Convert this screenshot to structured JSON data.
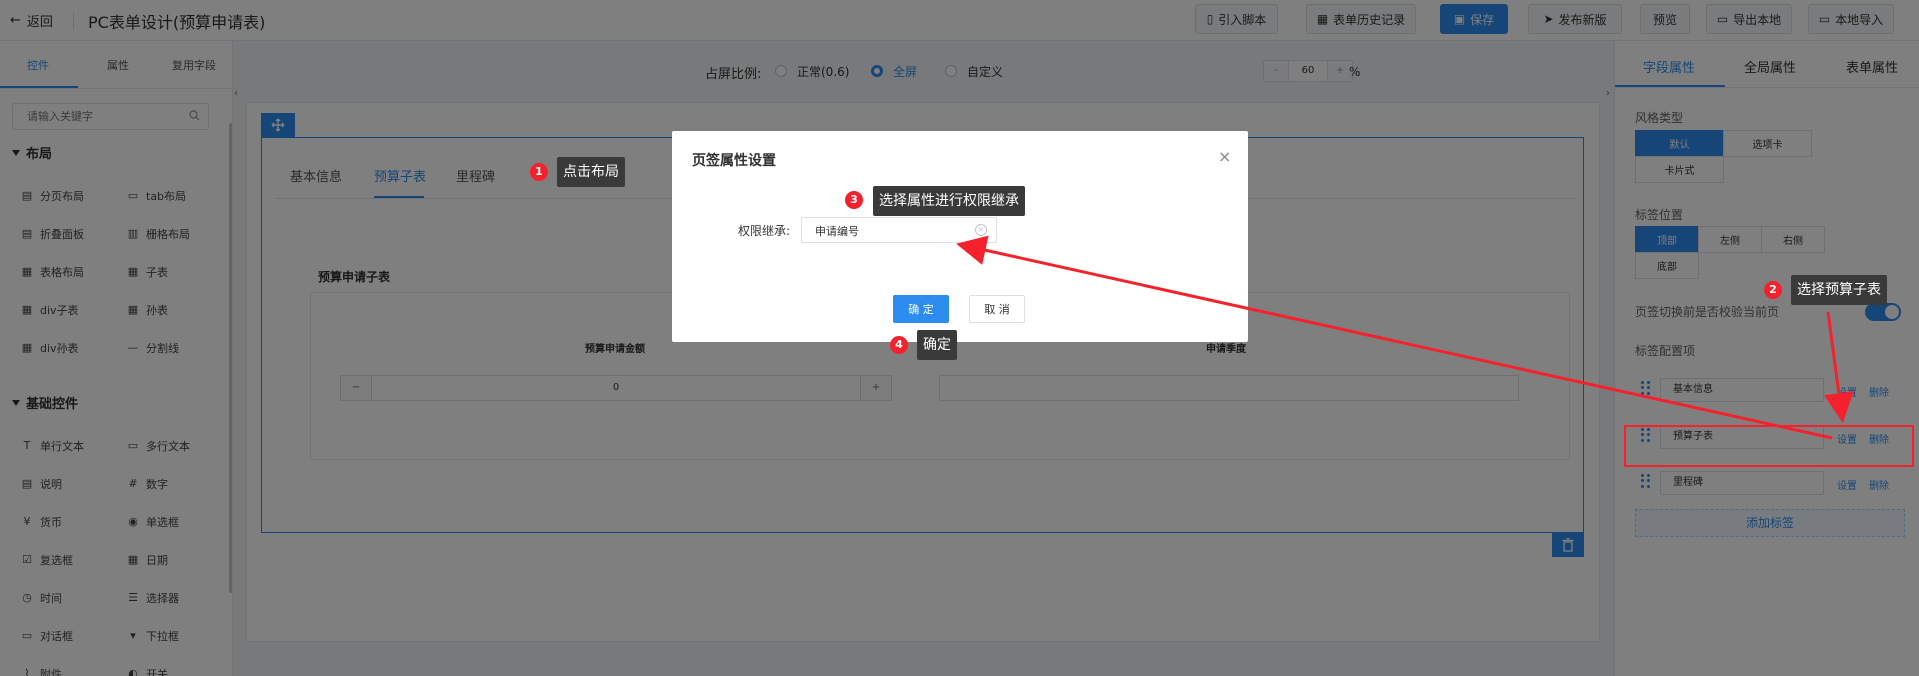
{
  "header": {
    "back_label": "返回",
    "title": "PC表单设计(预算申请表)",
    "buttons": {
      "import_script": "引入脚本",
      "history": "表单历史记录",
      "save": "保存",
      "publish": "发布新版",
      "preview": "预览",
      "export": "导出本地",
      "import_local": "本地导入"
    }
  },
  "left_panel": {
    "tabs": [
      "控件",
      "属性",
      "复用字段"
    ],
    "search_placeholder": "请输入关键字",
    "layout_group": "布局",
    "layout_items": [
      "分页布局",
      "tab布局",
      "折叠面板",
      "栅格布局",
      "表格布局",
      "子表",
      "div子表",
      "孙表",
      "div孙表",
      "分割线"
    ],
    "basic_group": "基础控件",
    "basic_items": [
      "单行文本",
      "多行文本",
      "说明",
      "数字",
      "货币",
      "单选框",
      "复选框",
      "日期",
      "时间",
      "选择器",
      "对话框",
      "下拉框",
      "附件",
      "开关"
    ]
  },
  "toolbar": {
    "ratio_label": "占屏比例:",
    "options": [
      "正常(0.6)",
      "全屏",
      "自定义"
    ],
    "selected": "全屏",
    "custom_value": "60",
    "minus": "-",
    "plus": "+",
    "unit": "%"
  },
  "canvas": {
    "tabs": [
      "基本信息",
      "预算子表",
      "里程碑"
    ],
    "active_tab": "预算子表",
    "subtable_title": "预算申请子表",
    "columns": [
      "预算申请金额",
      "申请季度"
    ],
    "amount_value": "0",
    "minus": "−",
    "plus": "+"
  },
  "right_panel": {
    "tabs": [
      "字段属性",
      "全局属性",
      "表单属性"
    ],
    "style_type_label": "风格类型",
    "style_options": [
      "默认",
      "选项卡",
      "卡片式"
    ],
    "style_selected": "默认",
    "tab_position_label": "标签位置",
    "position_options": [
      "顶部",
      "左侧",
      "右侧",
      "底部"
    ],
    "position_selected": "顶部",
    "validate_label": "页签切换前是否校验当前页",
    "validate_on": true,
    "tab_config_label": "标签配置项",
    "tab_items": [
      "基本信息",
      "预算子表",
      "里程碑"
    ],
    "set_label": "设置",
    "delete_label": "删除",
    "add_tag": "添加标签"
  },
  "dialog": {
    "title": "页签属性设置",
    "close": "×",
    "field_label": "权限继承:",
    "field_value": "申请编号",
    "ok": "确 定",
    "cancel": "取 消"
  },
  "annotations": {
    "step1": {
      "num": "1",
      "text": "点击布局"
    },
    "step2": {
      "num": "2",
      "text": "选择预算子表"
    },
    "step3": {
      "num": "3",
      "text": "选择属性进行权限继承"
    },
    "step4": {
      "num": "4",
      "text": "确定"
    },
    "accent": "#f5222d"
  },
  "colors": {
    "primary": "#2d8cf0",
    "callout_bg": "#3a3a3a",
    "annotation_red": "#f5222d"
  }
}
